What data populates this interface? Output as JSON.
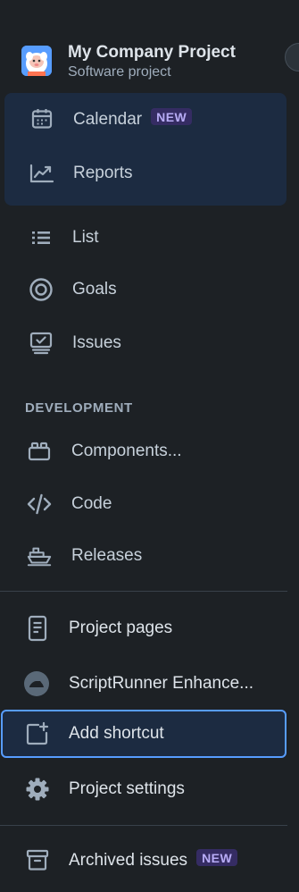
{
  "project": {
    "name": "My Company Project",
    "type": "Software project"
  },
  "nav": {
    "calendar": {
      "label": "Calendar",
      "badge": "NEW"
    },
    "reports": {
      "label": "Reports"
    },
    "list": {
      "label": "List"
    },
    "goals": {
      "label": "Goals"
    },
    "issues": {
      "label": "Issues"
    }
  },
  "development": {
    "heading": "DEVELOPMENT",
    "components": {
      "label": "Components..."
    },
    "code": {
      "label": "Code"
    },
    "releases": {
      "label": "Releases"
    }
  },
  "extras": {
    "project_pages": {
      "label": "Project pages"
    },
    "scriptrunner": {
      "label": "ScriptRunner Enhance..."
    },
    "add_shortcut": {
      "label": "Add shortcut"
    },
    "project_settings": {
      "label": "Project settings"
    }
  },
  "footer": {
    "archived": {
      "label": "Archived issues",
      "badge": "NEW"
    }
  },
  "colors": {
    "background": "#1d2125",
    "selected_group": "#1c2b41",
    "focus_ring": "#579dff",
    "badge_bg": "#352c63",
    "badge_text": "#b8acf6"
  }
}
